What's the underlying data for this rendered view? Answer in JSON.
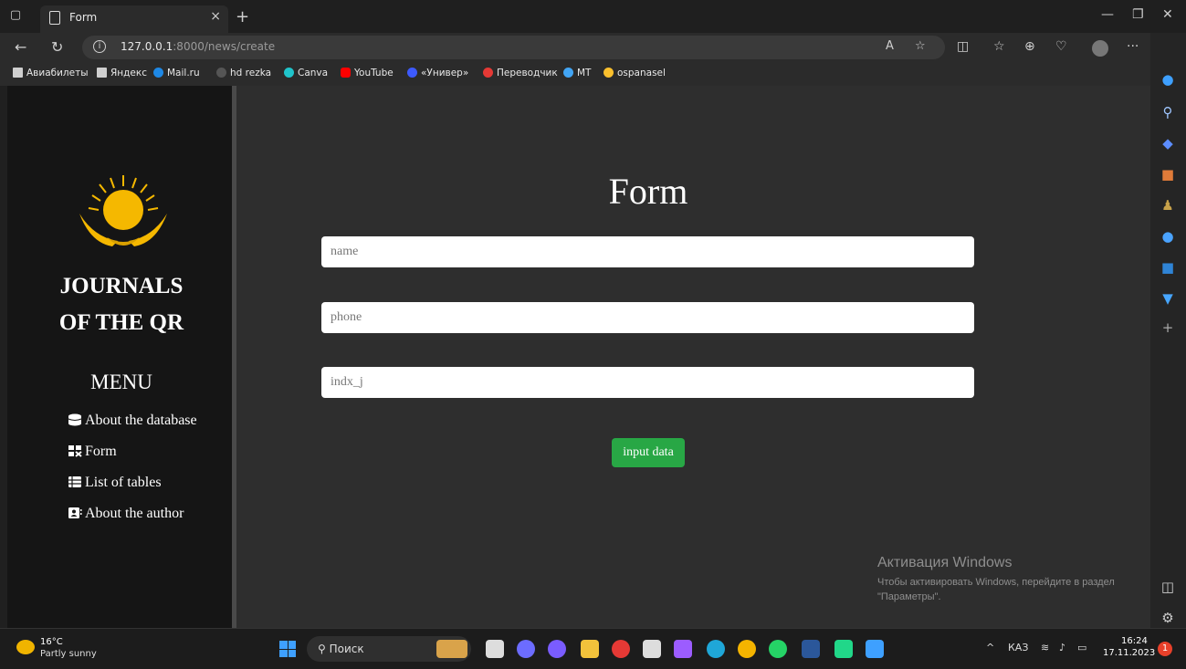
{
  "browser": {
    "tab_title": "Form",
    "tab_close": "×",
    "new_tab": "+",
    "url_host": "127.0.0.1",
    "url_path": ":8000/news/create",
    "more": "···"
  },
  "bookmarks": [
    {
      "label": "Авиабилеты",
      "color": "#cfcfcf"
    },
    {
      "label": "Яндекс",
      "color": "#cfcfcf"
    },
    {
      "label": "Mail.ru",
      "color": "#1e88e5"
    },
    {
      "label": "hd rezka",
      "color": "#555555"
    },
    {
      "label": "Canva",
      "color": "#20c4cb"
    },
    {
      "label": "YouTube",
      "color": "#ff0000"
    },
    {
      "label": "«Универ»",
      "color": "#3d5afe"
    },
    {
      "label": "Переводчик",
      "color": "#e53935"
    },
    {
      "label": "MT",
      "color": "#42a5f5"
    },
    {
      "label": "ospanasel",
      "color": "#fbc02d"
    }
  ],
  "sidebar": {
    "brand_line1": "JOURNALS",
    "brand_line2": "OF THE QR",
    "menu_title": "MENU",
    "items": [
      {
        "label": "About the database",
        "icon": "database-icon"
      },
      {
        "label": "Form",
        "icon": "form-icon"
      },
      {
        "label": "List of tables",
        "icon": "table-list-icon"
      },
      {
        "label": "About the author",
        "icon": "contact-card-icon"
      }
    ]
  },
  "form": {
    "title": "Form",
    "name_placeholder": "name",
    "phone_placeholder": "phone",
    "indx_placeholder": "indx_j",
    "submit_label": "input data"
  },
  "watermark": {
    "title": "Активация Windows",
    "text": "Чтобы активировать Windows, перейдите в раздел \"Параметры\"."
  },
  "taskbar": {
    "temp": "16°C",
    "weather": "Partly sunny",
    "search_label": "Поиск",
    "lang": "КАЗ",
    "time": "16:24",
    "date": "17.11.2023",
    "notifications": "1"
  },
  "colors": {
    "sidebar_bg": "#151515",
    "page_bg": "#2e2e2e",
    "submit_bg": "#28a745",
    "emblem": "#f5b800"
  }
}
